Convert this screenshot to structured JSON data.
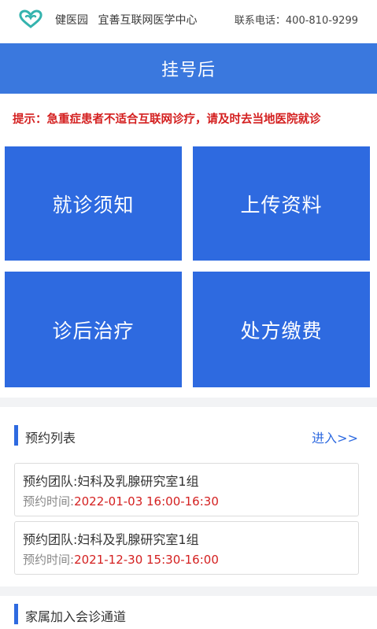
{
  "header": {
    "brand_name": "健医园",
    "center_name": "宜善互联网医学中心",
    "phone": "联系电话：400-810-9299",
    "logo_color": "#34b3ae"
  },
  "title": "挂号后",
  "notice": "提示：急重症患者不适合互联网诊疗，请及时去当地医院就诊",
  "tiles": [
    {
      "label": "就诊须知"
    },
    {
      "label": "上传资料"
    },
    {
      "label": "诊后治疗"
    },
    {
      "label": "处方缴费"
    }
  ],
  "appointments_section": {
    "title": "预约列表",
    "link": "进入>>"
  },
  "appointments": [
    {
      "team": "预约团队:妇科及乳腺研究室1组",
      "time_label": "预约时间:",
      "time": "2022-01-03 16:00-16:30"
    },
    {
      "team": "预约团队:妇科及乳腺研究室1组",
      "time_label": "预约时间:",
      "time": "2021-12-30 15:30-16:00"
    }
  ],
  "family_section": {
    "title": "家属加入会诊通道"
  },
  "colors": {
    "primary": "#2e6ae0",
    "title_bar": "#3a78de",
    "alert": "#d42020"
  }
}
